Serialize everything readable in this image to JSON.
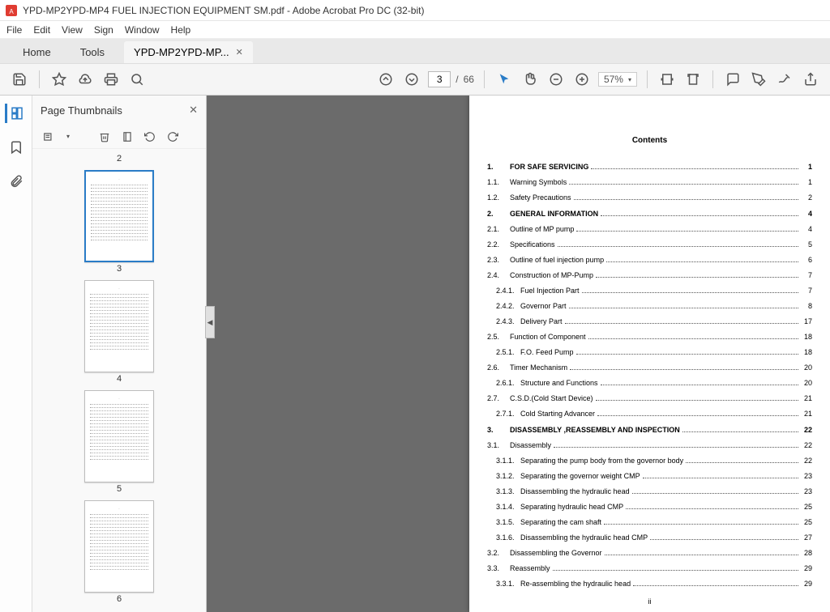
{
  "window": {
    "title": "YPD-MP2YPD-MP4 FUEL INJECTION EQUIPMENT SM.pdf - Adobe Acrobat Pro DC (32-bit)"
  },
  "menu": {
    "items": [
      "File",
      "Edit",
      "View",
      "Sign",
      "Window",
      "Help"
    ]
  },
  "tabs": {
    "home": "Home",
    "tools": "Tools",
    "doc": "YPD-MP2YPD-MP..."
  },
  "toolbar": {
    "page_current": "3",
    "page_total": "66",
    "zoom": "57%"
  },
  "thumbnails": {
    "title": "Page Thumbnails",
    "prelabel": "2",
    "pages": [
      {
        "num": "3",
        "selected": true
      },
      {
        "num": "4",
        "selected": false
      },
      {
        "num": "5",
        "selected": false
      },
      {
        "num": "6",
        "selected": false
      }
    ]
  },
  "contents": {
    "heading": "Contents",
    "footer": "ii",
    "rows": [
      {
        "lvl": 1,
        "num": "1.",
        "title": "FOR SAFE SERVICING",
        "pg": "1"
      },
      {
        "lvl": 2,
        "num": "1.1.",
        "title": "Warning Symbols",
        "pg": "1"
      },
      {
        "lvl": 2,
        "num": "1.2.",
        "title": "Safety Precautions",
        "pg": "2"
      },
      {
        "lvl": 1,
        "num": "2.",
        "title": "GENERAL INFORMATION",
        "pg": "4"
      },
      {
        "lvl": 2,
        "num": "2.1.",
        "title": "Outline of MP pump",
        "pg": "4"
      },
      {
        "lvl": 2,
        "num": "2.2.",
        "title": "Specifications",
        "pg": "5"
      },
      {
        "lvl": 2,
        "num": "2.3.",
        "title": "Outline of fuel injection pump",
        "pg": "6"
      },
      {
        "lvl": 2,
        "num": "2.4.",
        "title": "Construction of MP-Pump",
        "pg": "7"
      },
      {
        "lvl": 3,
        "num": "2.4.1.",
        "title": "Fuel Injection Part",
        "pg": "7"
      },
      {
        "lvl": 3,
        "num": "2.4.2.",
        "title": "Governor Part",
        "pg": "8"
      },
      {
        "lvl": 3,
        "num": "2.4.3.",
        "title": "Delivery Part",
        "pg": "17"
      },
      {
        "lvl": 2,
        "num": "2.5.",
        "title": "Function of Component",
        "pg": "18"
      },
      {
        "lvl": 3,
        "num": "2.5.1.",
        "title": "F.O. Feed Pump",
        "pg": "18"
      },
      {
        "lvl": 2,
        "num": "2.6.",
        "title": "Timer Mechanism",
        "pg": "20"
      },
      {
        "lvl": 3,
        "num": "2.6.1.",
        "title": "Structure and Functions",
        "pg": "20"
      },
      {
        "lvl": 2,
        "num": "2.7.",
        "title": "C.S.D.(Cold Start Device)",
        "pg": "21"
      },
      {
        "lvl": 3,
        "num": "2.7.1.",
        "title": "Cold Starting Advancer",
        "pg": "21"
      },
      {
        "lvl": 1,
        "num": "3.",
        "title": "DISASSEMBLY ,REASSEMBLY AND INSPECTION",
        "pg": "22"
      },
      {
        "lvl": 2,
        "num": "3.1.",
        "title": "Disassembly",
        "pg": "22"
      },
      {
        "lvl": 3,
        "num": "3.1.1.",
        "title": "Separating the pump body from the governor body",
        "pg": "22"
      },
      {
        "lvl": 3,
        "num": "3.1.2.",
        "title": "Separating the governor weight CMP",
        "pg": "23"
      },
      {
        "lvl": 3,
        "num": "3.1.3.",
        "title": "Disassembling the hydraulic head",
        "pg": "23"
      },
      {
        "lvl": 3,
        "num": "3.1.4.",
        "title": "Separating hydraulic head CMP",
        "pg": "25"
      },
      {
        "lvl": 3,
        "num": "3.1.5.",
        "title": "Separating the cam shaft",
        "pg": "25"
      },
      {
        "lvl": 3,
        "num": "3.1.6.",
        "title": "Disassembling the hydraulic head CMP",
        "pg": "27"
      },
      {
        "lvl": 2,
        "num": "3.2.",
        "title": "Disassembling the Governor",
        "pg": "28"
      },
      {
        "lvl": 2,
        "num": "3.3.",
        "title": "Reassembly",
        "pg": "29"
      },
      {
        "lvl": 3,
        "num": "3.3.1.",
        "title": "Re-assembling the hydraulic head",
        "pg": "29"
      }
    ]
  }
}
